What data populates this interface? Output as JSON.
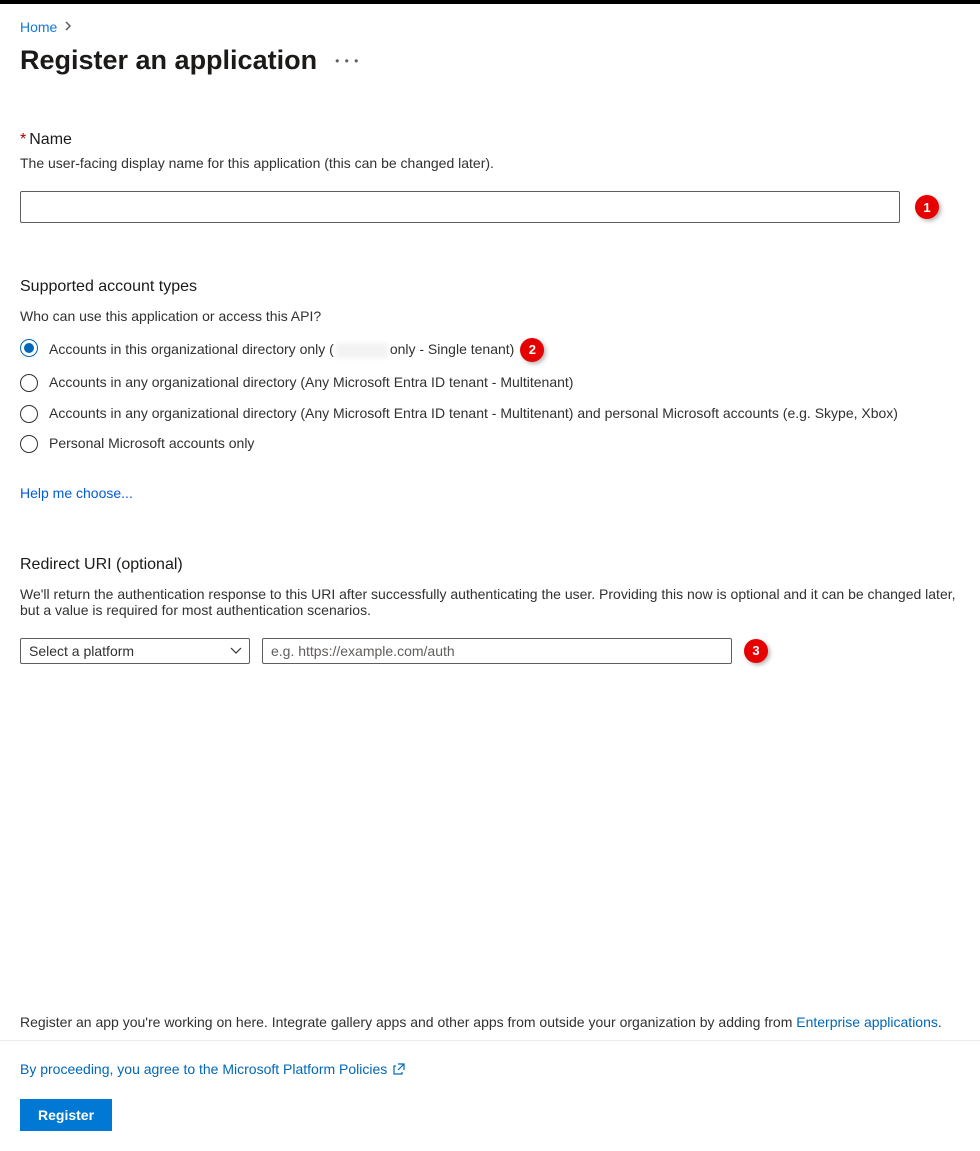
{
  "breadcrumb": {
    "home": "Home"
  },
  "page": {
    "title": "Register an application"
  },
  "name_section": {
    "label": "Name",
    "description": "The user-facing display name for this application (this can be changed later).",
    "value": ""
  },
  "account_section": {
    "title": "Supported account types",
    "question": "Who can use this application or access this API?",
    "options": {
      "opt1_prefix": "Accounts in this organizational directory only (",
      "opt1_suffix": " only - Single tenant)",
      "opt2": "Accounts in any organizational directory (Any Microsoft Entra ID tenant - Multitenant)",
      "opt3": "Accounts in any organizational directory (Any Microsoft Entra ID tenant - Multitenant) and personal Microsoft accounts (e.g. Skype, Xbox)",
      "opt4": "Personal Microsoft accounts only"
    },
    "help_link": "Help me choose..."
  },
  "redirect_section": {
    "title": "Redirect URI (optional)",
    "description": "We'll return the authentication response to this URI after successfully authenticating the user. Providing this now is optional and it can be changed later, but a value is required for most authentication scenarios.",
    "platform_placeholder": "Select a platform",
    "uri_placeholder": "e.g. https://example.com/auth"
  },
  "bottom_note": {
    "text": "Register an app you're working on here. Integrate gallery apps and other apps from outside your organization by adding from ",
    "link": "Enterprise applications",
    "period": "."
  },
  "footer": {
    "policy": "By proceeding, you agree to the Microsoft Platform Policies",
    "register": "Register"
  },
  "annotations": {
    "b1": "1",
    "b2": "2",
    "b3": "3"
  }
}
